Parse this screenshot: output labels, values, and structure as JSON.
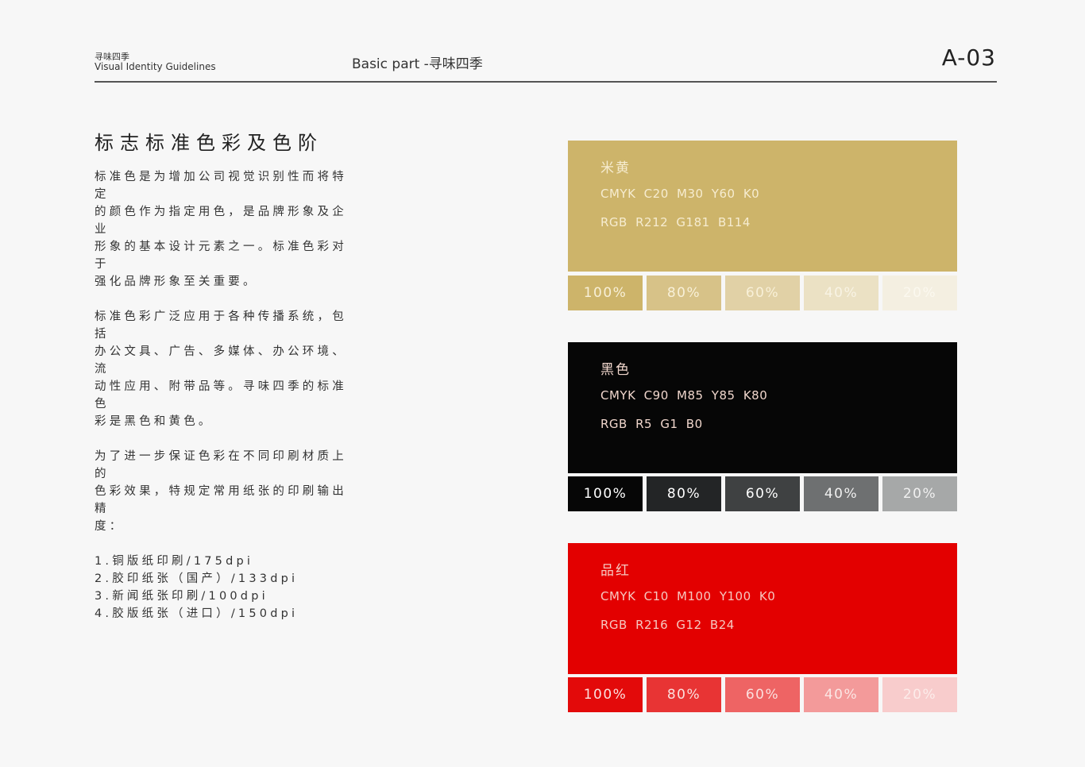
{
  "header": {
    "brand_cn": "寻味四季",
    "brand_en": "Visual Identity Guidelines",
    "section": "Basic part -寻味四季",
    "page_number": "A-03"
  },
  "content": {
    "title": "标志标准色彩及色阶",
    "paragraphs": [
      "标准色是为增加公司视觉识别性而将特定\n的颜色作为指定用色，是品牌形象及企业\n形象的基本设计元素之一。标准色彩对于\n强化品牌形象至关重要。",
      "标准色彩广泛应用于各种传播系统，包括\n办公文具、广告、多媒体、办公环境、流\n动性应用、附带品等。寻味四季的标准色\n彩是黑色和黄色。",
      "为了进一步保证色彩在不同印刷材质上的\n色彩效果，特规定常用纸张的印刷输出精\n度："
    ],
    "list": [
      "1.铜版纸印刷/175dpi",
      "2.胶印纸张（国产）/133dpi",
      "3.新闻纸张印刷/100dpi",
      "4.胶版纸张（进口）/150dpi"
    ]
  },
  "colors": [
    {
      "name": "米黄",
      "cmyk": "CMYK  C20  M30  Y60  K0",
      "rgb": "RGB   R212  G181  B114",
      "hex": "#cdb46a",
      "text_color": "#f6ecd0",
      "tints": [
        {
          "label": "100%",
          "bg": "#cdb46a",
          "fg": "#f8f0d8"
        },
        {
          "label": "80%",
          "bg": "#d7c288",
          "fg": "#f8f0d8"
        },
        {
          "label": "60%",
          "bg": "#e1d1a6",
          "fg": "#f8f0d8"
        },
        {
          "label": "40%",
          "bg": "#ebe1c4",
          "fg": "#f8f3e4"
        },
        {
          "label": "20%",
          "bg": "#f4efe1",
          "fg": "#fbf8ef"
        }
      ]
    },
    {
      "name": "黑色",
      "cmyk": "CMYK  C90  M85  Y85  K80",
      "rgb": "RGB   R5  G1  B0",
      "hex": "#060606",
      "text_color": "#f0d6cc",
      "tints": [
        {
          "label": "100%",
          "bg": "#060606",
          "fg": "#ffffff"
        },
        {
          "label": "80%",
          "bg": "#232526",
          "fg": "#ffffff"
        },
        {
          "label": "60%",
          "bg": "#3f4142",
          "fg": "#ffffff"
        },
        {
          "label": "40%",
          "bg": "#6e7071",
          "fg": "#f0f0f0"
        },
        {
          "label": "20%",
          "bg": "#a6a8a8",
          "fg": "#f0f0f0"
        }
      ]
    },
    {
      "name": "品红",
      "cmyk": "CMYK  C10  M100  Y100  K0",
      "rgb": "RGB   R216  G12  B24",
      "hex": "#e30000",
      "text_color": "#f6c8c0",
      "tints": [
        {
          "label": "100%",
          "bg": "#e30a0a",
          "fg": "#fbe0de"
        },
        {
          "label": "80%",
          "bg": "#e83434",
          "fg": "#fbe0de"
        },
        {
          "label": "60%",
          "bg": "#ee6464",
          "fg": "#fbe0de"
        },
        {
          "label": "40%",
          "bg": "#f39a9a",
          "fg": "#fbe6e4"
        },
        {
          "label": "20%",
          "bg": "#f8cccc",
          "fg": "#fcecea"
        }
      ]
    }
  ]
}
